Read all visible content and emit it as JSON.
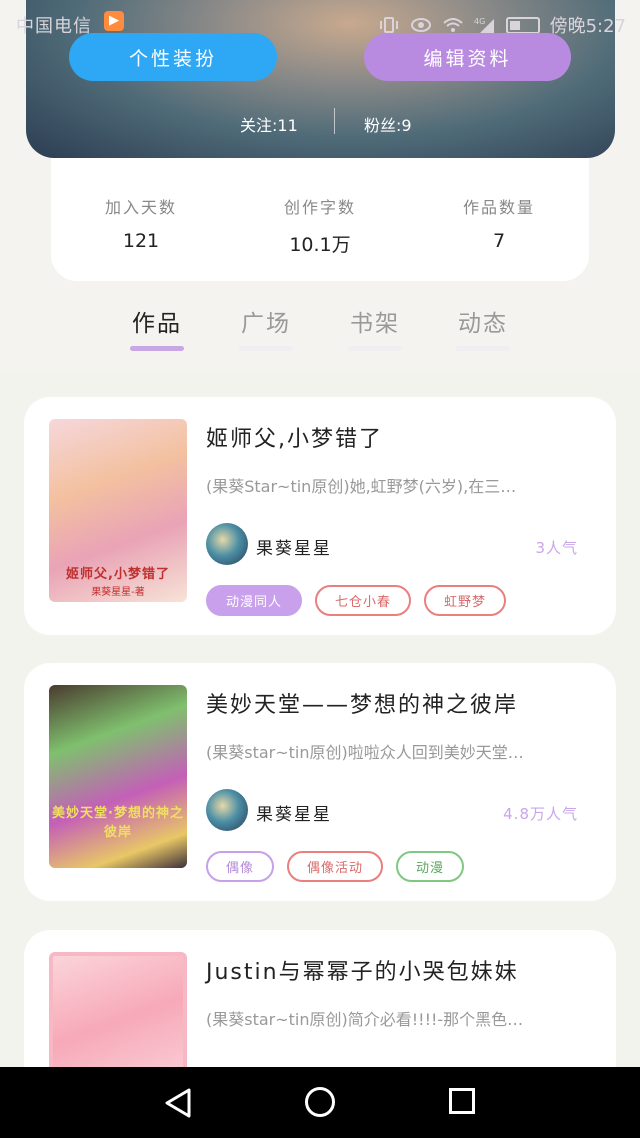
{
  "status_bar": {
    "carrier": "中国电信",
    "carrier_app_icon": "orange-app-badge",
    "network": "4G",
    "time": "傍晚5:27",
    "icons": [
      "vibrate-icon",
      "eye-icon",
      "wifi-icon",
      "signal-icon",
      "battery-icon"
    ]
  },
  "profile": {
    "dressup_button": "个性装扮",
    "edit_button": "编辑资料",
    "follow": "关注:11",
    "fans": "粉丝:9"
  },
  "stats": [
    {
      "label": "加入天数",
      "value": "121"
    },
    {
      "label": "创作字数",
      "value": "10.1万"
    },
    {
      "label": "作品数量",
      "value": "7"
    }
  ],
  "tabs": [
    {
      "label": "作品",
      "active": true
    },
    {
      "label": "广场",
      "active": false
    },
    {
      "label": "书架",
      "active": false
    },
    {
      "label": "动态",
      "active": false
    }
  ],
  "books": [
    {
      "title": "姬师父,小梦错了",
      "description": "(果葵Star~tin原创)她,虹野梦(六岁),在三…",
      "author": "果葵星星",
      "popularity": "3人气",
      "cover_caption": "姬师父,小梦错了",
      "cover_sub": "果葵星星-著",
      "tags": [
        {
          "label": "动漫同人",
          "style": "purple-fill"
        },
        {
          "label": "七仓小春",
          "style": "red"
        },
        {
          "label": "虹野梦",
          "style": "red"
        }
      ]
    },
    {
      "title": "美妙天堂——梦想的神之彼岸",
      "description": "(果葵star~tin原创)啦啦众人回到美妙天堂…",
      "author": "果葵星星",
      "popularity": "4.8万人气",
      "cover_caption": "美妙天堂·梦想的神之彼岸",
      "cover_sub": "",
      "tags": [
        {
          "label": "偶像",
          "style": "purple"
        },
        {
          "label": "偶像活动",
          "style": "red"
        },
        {
          "label": "动漫",
          "style": "green"
        }
      ]
    },
    {
      "title": "Justin与幂幂子的小哭包妹妹",
      "description": "(果葵star~tin原创)简介必看!!!!-那个黑色…",
      "author": "",
      "popularity": "",
      "cover_caption": "",
      "cover_sub": "",
      "tags": []
    }
  ],
  "colors": {
    "dressup_blue": "#2ea7f5",
    "edit_purple": "#b98be0",
    "tab_accent": "#c7a7e4",
    "popularity_purple": "#c9a6ea"
  },
  "nav": {
    "back_icon": "triangle-back-icon",
    "home_icon": "circle-home-icon",
    "recent_icon": "square-recent-icon"
  }
}
